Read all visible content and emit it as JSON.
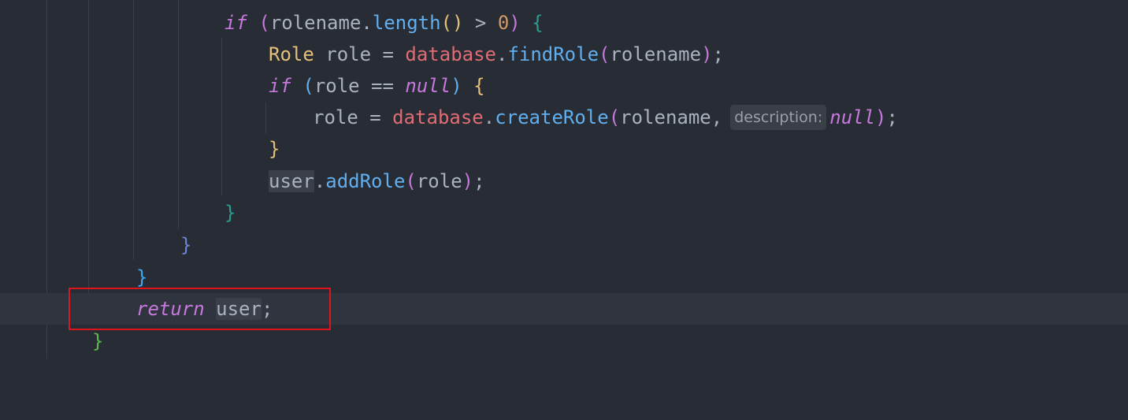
{
  "editor": {
    "language": "java",
    "hint_description": "description:",
    "lines": {
      "l1": {
        "kw_if": "if",
        "paren_open": "(",
        "var": "rolename",
        "dot": ".",
        "method": "length",
        "call": "()",
        "op": " > ",
        "num": "0",
        "paren_close": ")",
        "brace": "{"
      },
      "l2": {
        "type": "Role",
        "var": " role = ",
        "field": "database",
        "dot": ".",
        "method": "findRole",
        "paren_open": "(",
        "arg": "rolename",
        "paren_close": ")",
        "semi": ";"
      },
      "l3": {
        "kw_if": "if",
        "paren_open": "(",
        "cond": "role == ",
        "kw_null": "null",
        "paren_close": ")",
        "brace": "{"
      },
      "l4": {
        "var": "role = ",
        "field": "database",
        "dot": ".",
        "method": "createRole",
        "paren_open": "(",
        "arg": "rolename,",
        "kw_null": "null",
        "paren_close": ")",
        "semi": ";"
      },
      "l5": {
        "brace": "}"
      },
      "l6": {
        "var": "user",
        "dot": ".",
        "method": "addRole",
        "paren_open": "(",
        "arg": "role",
        "paren_close": ")",
        "semi": ";"
      },
      "l7": {
        "brace": "}"
      },
      "l8": {
        "brace": "}"
      },
      "l9": {
        "brace": "}"
      },
      "l10": {
        "kw_return": "return",
        "var": "user",
        "semi": ";"
      },
      "l11": {
        "brace": "}"
      }
    }
  },
  "colors": {
    "background": "#282c34",
    "current_line": "#2f343e",
    "keyword": "#c678dd",
    "type": "#e5c07b",
    "field": "#e06c75",
    "method": "#61afef",
    "number": "#d19a66",
    "highlight_box": "#e0141c"
  }
}
